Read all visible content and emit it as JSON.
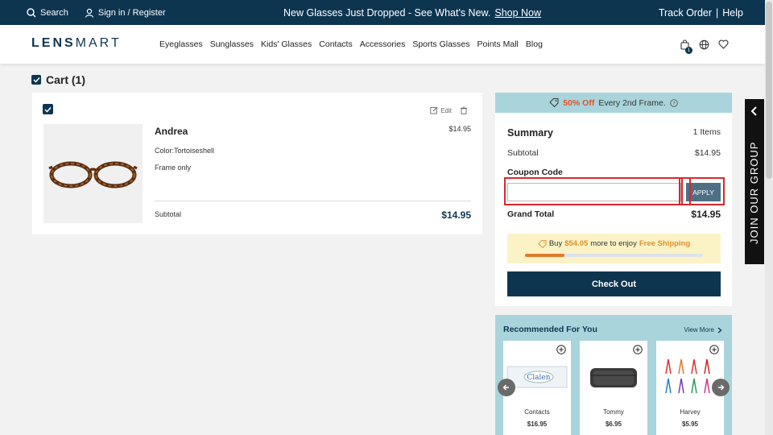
{
  "topbar": {
    "search_label": "Search",
    "signin_label": "Sign in / Register",
    "announcement": "New Glasses Just Dropped - See What's New.",
    "shop_now": "Shop Now",
    "track_order": "Track Order",
    "separator": "|",
    "help": "Help"
  },
  "nav": {
    "logo_bold": "LENS",
    "logo_light": "MART",
    "links": [
      "Eyeglasses",
      "Sunglasses",
      "Kids' Glasses",
      "Contacts",
      "Accessories",
      "Sports Glasses",
      "Points Mall",
      "Blog"
    ],
    "cart_count": "1"
  },
  "cart": {
    "heading": "Cart (1)",
    "edit_label": "Edit",
    "item": {
      "name": "Andrea",
      "price": "$14.95",
      "color": "Color:Tortoiseshell",
      "frame": "Frame only",
      "subtotal_label": "Subtotal",
      "subtotal_value": "$14.95"
    }
  },
  "promo": {
    "highlight": "50% Off",
    "text": "Every 2nd Frame."
  },
  "summary": {
    "title": "Summary",
    "items_count": "1 Items",
    "subtotal_label": "Subtotal",
    "subtotal_value": "$14.95",
    "coupon_label": "Coupon Code",
    "coupon_value": "",
    "apply_label": "APPLY",
    "grand_total_label": "Grand Total",
    "grand_total_value": "$14.95",
    "shipping": {
      "buy": "Buy",
      "amount": "$54.05",
      "middle": "more to enjoy",
      "free": "Free Shipping",
      "progress_fraction": 0.22
    },
    "checkout_label": "Check Out"
  },
  "recommended": {
    "title": "Recommended For You",
    "view_more": "View More",
    "products": [
      {
        "name": "Contacts",
        "price": "$16.95",
        "brand_text": "Clalen"
      },
      {
        "name": "Tommy",
        "price": "$6.95"
      },
      {
        "name": "Harvey",
        "price": "$5.95"
      }
    ]
  },
  "side_tab": {
    "label": "JOIN OUR GROUP"
  },
  "colors": {
    "navy": "#0d3550",
    "accent_orange": "#e0532c",
    "promo_bg": "#a9d4dc",
    "highlight_red": "#d9282c"
  }
}
